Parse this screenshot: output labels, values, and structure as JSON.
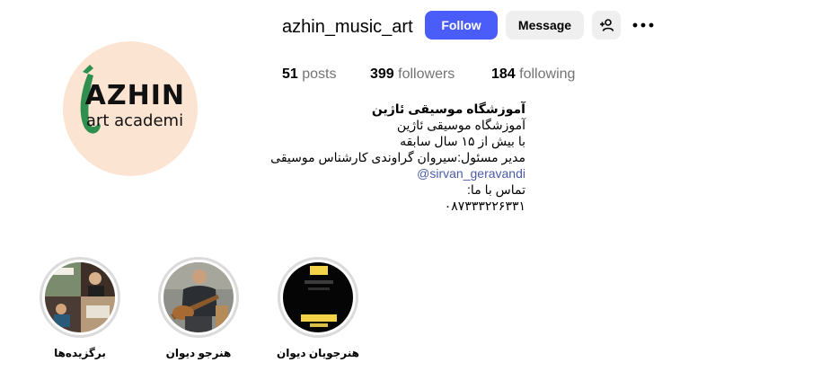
{
  "profile": {
    "username": "azhin_music_art",
    "logo_text": "AZHIN",
    "logo_subtext": "art academi"
  },
  "actions": {
    "follow_label": "Follow",
    "message_label": "Message",
    "add_user_icon": "person-plus-icon",
    "more_icon": "more-options-icon"
  },
  "stats": {
    "posts_count": "51",
    "posts_label": "posts",
    "followers_count": "399",
    "followers_label": "followers",
    "following_count": "184",
    "following_label": "following"
  },
  "bio": {
    "name": "آموزشگاه موسیقی ئاژین",
    "lines": [
      "آموزشگاه موسیقی ئاژین",
      "با بیش از ۱۵ سال سابقه",
      "مدیر مسئول:سیروان گراوندی کارشناس موسیقی"
    ],
    "mention": "@sirvan_geravandi",
    "contact_label": "تماس با ما:",
    "phone": "۰۸۷۳۳۳۲۲۶۳۳۱"
  },
  "highlights": [
    {
      "label": "برگزیده‌ها"
    },
    {
      "label": "هنرجو دیوان"
    },
    {
      "label": "هنرجویان دیوان"
    }
  ],
  "colors": {
    "follow_button": "#4a5df9",
    "secondary_button": "#efefef",
    "link": "#4a5ba8",
    "muted_text": "#737373",
    "avatar_bg": "#fbe4d2"
  }
}
